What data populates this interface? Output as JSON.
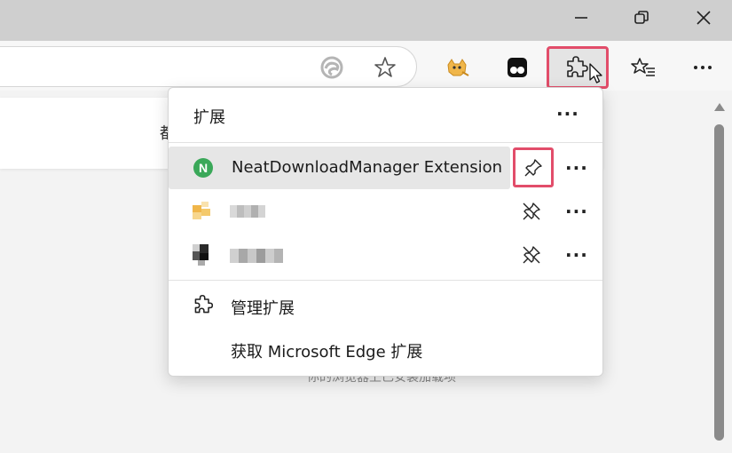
{
  "window": {
    "minimize_icon": "minimize-icon",
    "restore_icon": "restore-icon",
    "close_icon": "close-icon"
  },
  "toolbar": {
    "edge_icon": "edge-logo-icon",
    "favorite_icon": "star-icon",
    "extension_icons": [
      "tampermonkey-icon",
      "tampermonkey-dots-icon"
    ],
    "extensions_button_icon": "puzzle-icon",
    "favorites_icon": "favorites-list-icon",
    "more_icon": "more-icon"
  },
  "page": {
    "card_text": "都",
    "bottom_text": "你的浏览器上已安装加载项"
  },
  "extensions_popup": {
    "title": "扩展",
    "more": "···",
    "items": [
      {
        "name": "NeatDownloadManager Extension",
        "icon_letter": "N",
        "pinned": true,
        "more": "···"
      },
      {
        "name": "",
        "pinned": false,
        "more": "···"
      },
      {
        "name": "",
        "pinned": false,
        "more": "···"
      }
    ],
    "manage_label": "管理扩展",
    "get_label": "获取 Microsoft Edge 扩展"
  },
  "colors": {
    "highlight": "#e24d6a",
    "neat_green": "#3aa859"
  }
}
